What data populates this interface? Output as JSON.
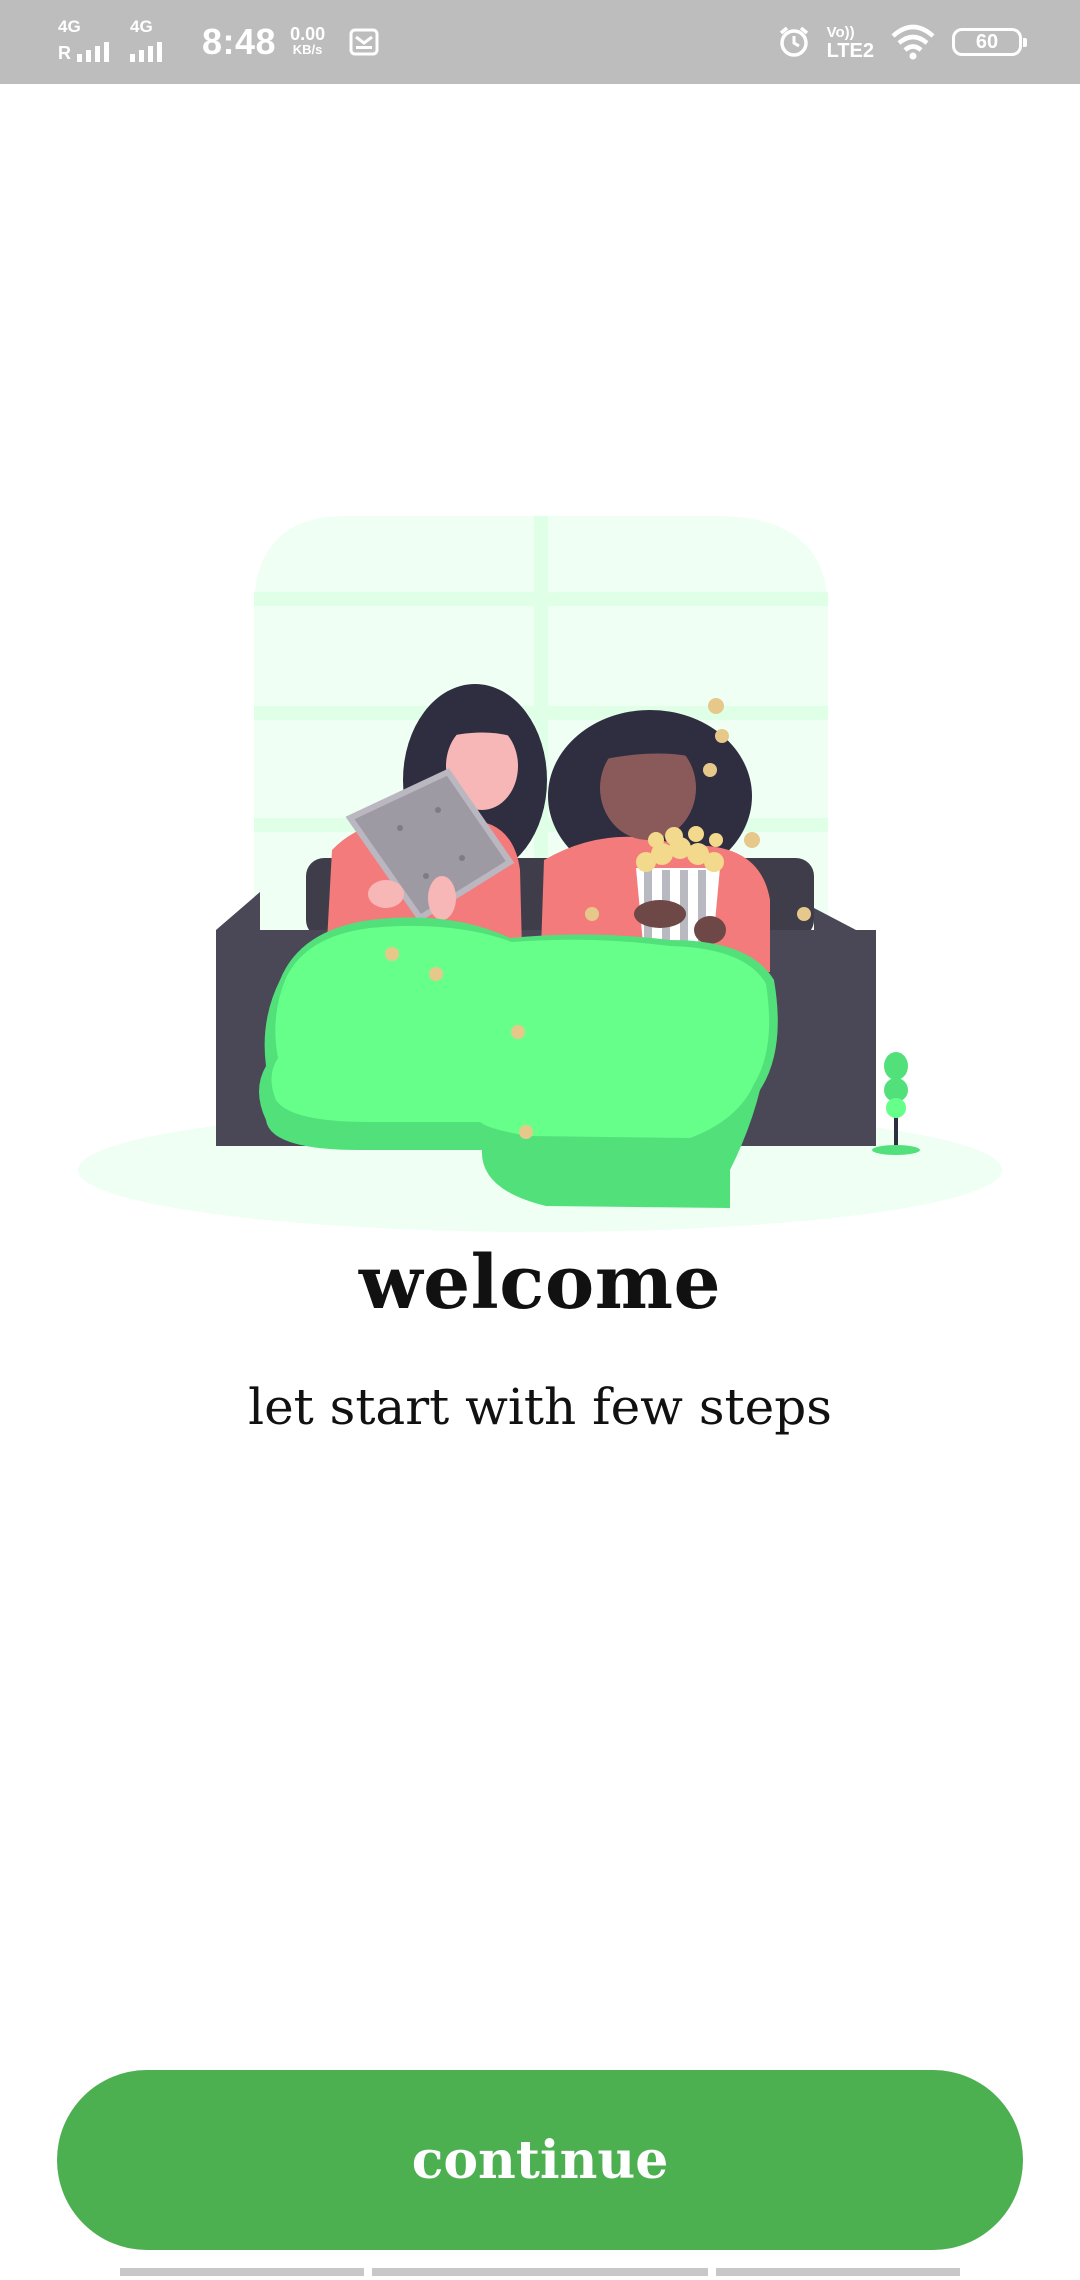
{
  "status_bar": {
    "sim1_tech": "4G",
    "sim1_roaming": "R",
    "sim2_tech": "4G",
    "time": "8:48",
    "net_speed_value": "0.00",
    "net_speed_unit": "KB/s",
    "volte_label": "Vo))",
    "lte_label": "LTE2",
    "battery_level": "60"
  },
  "onboarding": {
    "title": "welcome",
    "subtitle": "let start with few steps"
  },
  "actions": {
    "continue_label": "continue"
  },
  "colors": {
    "primary_green": "#4caf50",
    "blanket_green": "#66ff8a",
    "window_tint": "#effff3",
    "sofa": "#4a4757",
    "status_bar_bg": "#bdbdbd"
  },
  "icons": {
    "status": [
      "signal-icon",
      "mail-notification-icon",
      "alarm-icon",
      "wifi-icon",
      "battery-icon"
    ]
  },
  "progress": {
    "steps_total": 3
  }
}
